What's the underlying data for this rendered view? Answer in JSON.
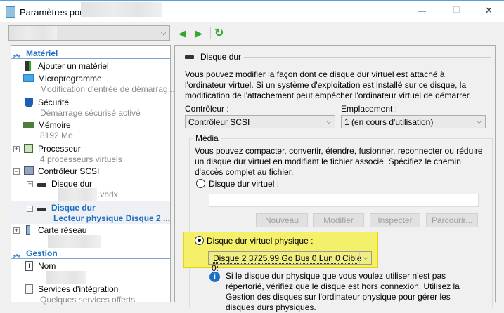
{
  "window": {
    "title": "Paramètres pour",
    "minimize": "—",
    "maximize": "☐",
    "close": "✕"
  },
  "toolbar": {
    "back": "◀",
    "forward": "▶",
    "refresh": "↻",
    "vm_combo_chevron": "⌵"
  },
  "tree": {
    "hardware_header": "Matériel",
    "items": [
      {
        "label": "Ajouter un matériel"
      },
      {
        "label": "Microprogramme",
        "sub": "Modification d'entrée de démarrag..."
      },
      {
        "label": "Sécurité",
        "sub": "Démarrage sécurisé activé"
      },
      {
        "label": "Mémoire",
        "sub": "8192 Mo"
      },
      {
        "label": "Processeur",
        "sub": "4 processeurs virtuels"
      },
      {
        "label": "Contrôleur SCSI"
      },
      {
        "label": "Disque dur",
        "sub": ".vhdx"
      },
      {
        "label": "Disque dur",
        "sub": "Lecteur physique Disque 2 ..."
      },
      {
        "label": "Carte réseau"
      }
    ],
    "management_header": "Gestion",
    "mgmt_items": [
      {
        "label": "Nom"
      },
      {
        "label": "Services d'intégration",
        "sub": "Quelques services offerts"
      }
    ]
  },
  "panel": {
    "title": "Disque dur",
    "description": "Vous pouvez modifier la façon dont ce disque dur virtuel est attaché à l'ordinateur virtuel. Si un système d'exploitation est installé sur ce disque, la modification de l'attachement peut empêcher l'ordinateur virtuel de démarrer.",
    "controller_label": "Contrôleur :",
    "controller_value": "Contrôleur SCSI",
    "location_label": "Emplacement :",
    "location_value": "1 (en cours d'utilisation)",
    "media_label": "Média",
    "media_description": "Vous pouvez compacter, convertir, étendre, fusionner, reconnecter ou réduire un disque dur virtuel en modifiant le fichier associé. Spécifiez le chemin d'accès complet au fichier.",
    "virtual_disk_radio": "Disque dur virtuel :",
    "virtual_disk_path": "",
    "buttons": {
      "new": "Nouveau",
      "edit": "Modifier",
      "inspect": "Inspecter",
      "browse": "Parcourir..."
    },
    "physical_disk_radio": "Disque dur virtuel physique :",
    "physical_disk_value": "Disque 2 3725.99 Go Bus 0 Lun 0 Cible 0",
    "info_text": "Si le disque dur physique que vous voulez utiliser n'est pas répertorié, vérifiez que le disque est hors connexion. Utilisez la Gestion des disques sur l'ordinateur physique pour gérer les disques durs physiques."
  },
  "colors": {
    "accent": "#1e6fc4",
    "highlight": "#f5f06a",
    "selected_row": "#eef0f3"
  }
}
